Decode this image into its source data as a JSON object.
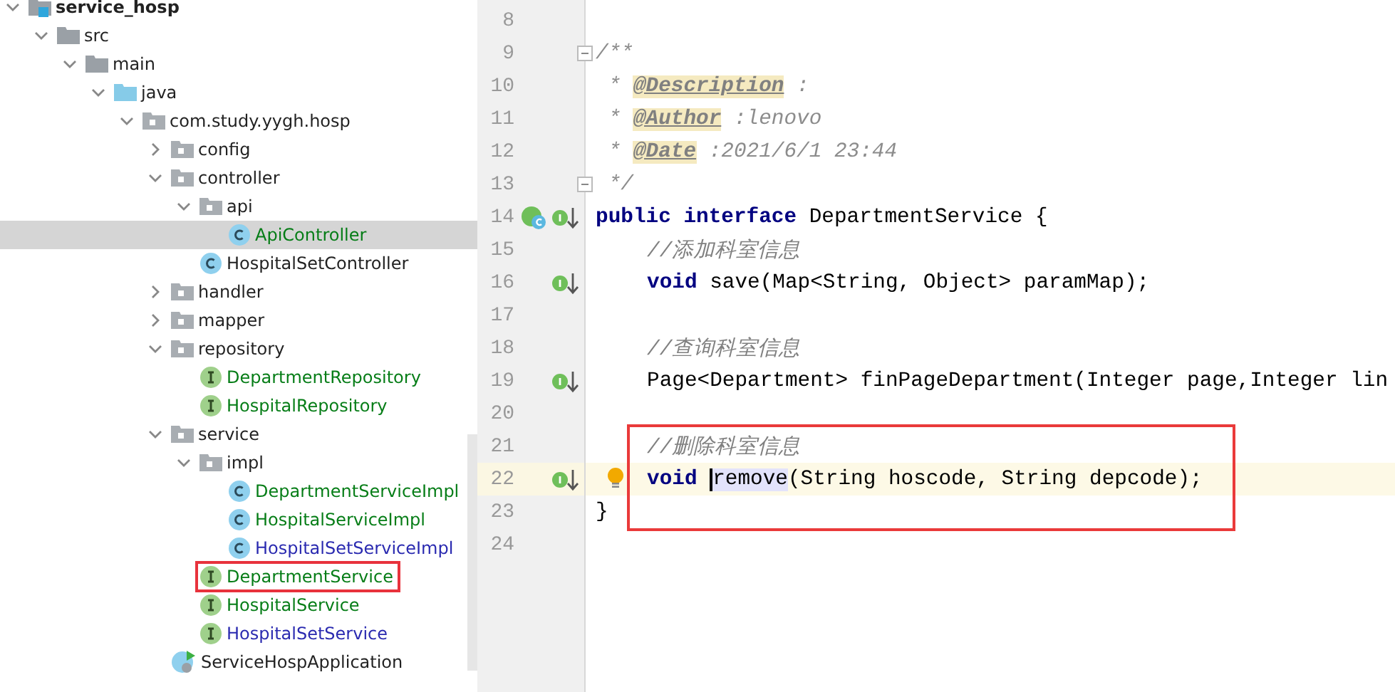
{
  "project_tree": {
    "items": [
      {
        "label": "service_hosp",
        "kind": "module",
        "expanded": true,
        "children": [
          {
            "label": "src",
            "kind": "folder",
            "expanded": true,
            "children": [
              {
                "label": "main",
                "kind": "folder",
                "expanded": true,
                "children": [
                  {
                    "label": "java",
                    "kind": "source-folder",
                    "expanded": true,
                    "children": [
                      {
                        "label": "com.study.yygh.hosp",
                        "kind": "package",
                        "expanded": true,
                        "children": [
                          {
                            "label": "config",
                            "kind": "package",
                            "expanded": false
                          },
                          {
                            "label": "controller",
                            "kind": "package",
                            "expanded": true,
                            "children": [
                              {
                                "label": "api",
                                "kind": "package",
                                "expanded": true,
                                "children": [
                                  {
                                    "label": "ApiController",
                                    "kind": "class",
                                    "color": "#067d17",
                                    "selected": true,
                                    "marked": false
                                  }
                                ]
                              },
                              {
                                "label": "HospitalSetController",
                                "kind": "class",
                                "selected": false,
                                "marked": false
                              }
                            ]
                          },
                          {
                            "label": "handler",
                            "kind": "package",
                            "expanded": false
                          },
                          {
                            "label": "mapper",
                            "kind": "package",
                            "expanded": false
                          },
                          {
                            "label": "repository",
                            "kind": "package",
                            "expanded": true,
                            "children": [
                              {
                                "label": "DepartmentRepository",
                                "kind": "interface",
                                "color": "#067d17",
                                "selected": false,
                                "marked": false
                              },
                              {
                                "label": "HospitalRepository",
                                "kind": "interface",
                                "color": "#067d17",
                                "selected": false,
                                "marked": false
                              }
                            ]
                          },
                          {
                            "label": "service",
                            "kind": "package",
                            "expanded": true,
                            "children": [
                              {
                                "label": "impl",
                                "kind": "package",
                                "expanded": true,
                                "children": [
                                  {
                                    "label": "DepartmentServiceImpl",
                                    "kind": "class",
                                    "color": "#067d17",
                                    "selected": false,
                                    "marked": false
                                  },
                                  {
                                    "label": "HospitalServiceImpl",
                                    "kind": "class",
                                    "color": "#067d17",
                                    "selected": false,
                                    "marked": false
                                  },
                                  {
                                    "label": "HospitalSetServiceImpl",
                                    "kind": "class",
                                    "color": "#2a2ab0",
                                    "selected": false,
                                    "marked": false
                                  }
                                ]
                              },
                              {
                                "label": "DepartmentService",
                                "kind": "interface",
                                "color": "#067d17",
                                "selected": false,
                                "marked": true
                              },
                              {
                                "label": "HospitalService",
                                "kind": "interface",
                                "color": "#067d17",
                                "selected": false,
                                "marked": false
                              },
                              {
                                "label": "HospitalSetService",
                                "kind": "interface",
                                "color": "#2a2ab0",
                                "selected": false,
                                "marked": false
                              }
                            ]
                          },
                          {
                            "label": "ServiceHospApplication",
                            "kind": "app",
                            "selected": false,
                            "marked": false
                          }
                        ]
                      }
                    ]
                  }
                ]
              }
            ]
          }
        ]
      }
    ]
  },
  "editor": {
    "lines": [
      {
        "number": "8"
      },
      {
        "number": "9",
        "fold": true,
        "tokens": [
          {
            "kind": "doc",
            "text": "/**"
          }
        ]
      },
      {
        "number": "10",
        "tokens": [
          {
            "kind": "doc",
            "text": " * "
          },
          {
            "kind": "doc-tag",
            "text": "@Description"
          },
          {
            "kind": "doc",
            "text": " :"
          }
        ]
      },
      {
        "number": "11",
        "tokens": [
          {
            "kind": "doc",
            "text": " * "
          },
          {
            "kind": "doc-tag",
            "text": "@Author"
          },
          {
            "kind": "doc",
            "text": " :lenovo"
          }
        ]
      },
      {
        "number": "12",
        "tokens": [
          {
            "kind": "doc",
            "text": " * "
          },
          {
            "kind": "doc-tag",
            "text": "@Date"
          },
          {
            "kind": "doc",
            "text": " :2021/6/1 23:44"
          }
        ]
      },
      {
        "number": "13",
        "fold": true,
        "tokens": [
          {
            "kind": "doc",
            "text": " */"
          }
        ]
      },
      {
        "number": "14",
        "implemented_class": true,
        "implemented_interface": true,
        "tokens": [
          {
            "kind": "keyword",
            "text": "public interface "
          },
          {
            "kind": "plain",
            "text": "DepartmentService {"
          }
        ]
      },
      {
        "number": "15",
        "indented": true,
        "tokens": [
          {
            "kind": "comment",
            "text": "//添加科室信息"
          }
        ]
      },
      {
        "number": "16",
        "indented": true,
        "implemented_interface": true,
        "tokens": [
          {
            "kind": "keyword",
            "text": "void "
          },
          {
            "kind": "plain",
            "text": "save(Map<String, Object> paramMap);"
          }
        ]
      },
      {
        "number": "17"
      },
      {
        "number": "18",
        "indented": true,
        "tokens": [
          {
            "kind": "comment",
            "text": "//查询科室信息"
          }
        ]
      },
      {
        "number": "19",
        "indented": true,
        "implemented_interface": true,
        "tokens": [
          {
            "kind": "plain",
            "text": "Page<Department> finPageDepartment(Integer page,Integer lin"
          }
        ]
      },
      {
        "number": "20"
      },
      {
        "number": "21",
        "indented": true,
        "boxed": true,
        "tokens": [
          {
            "kind": "comment",
            "text": "//删除科室信息"
          }
        ]
      },
      {
        "number": "22",
        "indented": true,
        "boxed": true,
        "current": true,
        "bulb": true,
        "implemented_interface": true,
        "tokens": [
          {
            "kind": "keyword",
            "text": "void "
          },
          {
            "kind": "usage",
            "text": "remove",
            "caret": true
          },
          {
            "kind": "plain",
            "text": "(String hoscode, String depcode);"
          }
        ]
      },
      {
        "number": "23",
        "boxed": true,
        "tokens": [
          {
            "kind": "plain",
            "text": "}"
          }
        ]
      },
      {
        "number": "24"
      }
    ]
  }
}
